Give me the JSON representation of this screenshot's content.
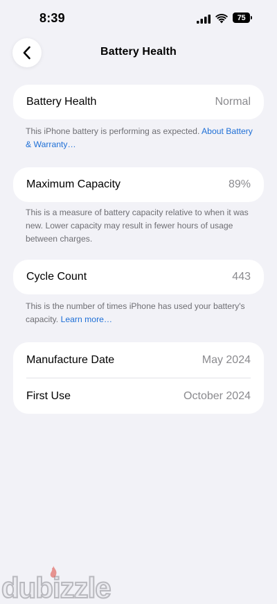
{
  "status_bar": {
    "time": "8:39",
    "battery_level": "75"
  },
  "nav": {
    "title": "Battery Health"
  },
  "health_card": {
    "label": "Battery Health",
    "value": "Normal"
  },
  "health_note": {
    "text": "This iPhone battery is performing as expected. ",
    "link": "About Battery & Warranty…"
  },
  "capacity_card": {
    "label": "Maximum Capacity",
    "value": "89%"
  },
  "capacity_note": {
    "text": "This is a measure of battery capacity relative to when it was new. Lower capacity may result in fewer hours of usage between charges."
  },
  "cycle_card": {
    "label": "Cycle Count",
    "value": "443"
  },
  "cycle_note": {
    "text": "This is the number of times iPhone has used your battery's capacity. ",
    "link": "Learn more…"
  },
  "dates_card": {
    "manufacture_label": "Manufacture Date",
    "manufacture_value": "May 2024",
    "first_use_label": "First Use",
    "first_use_value": "October 2024"
  },
  "watermark": {
    "text": "dubizzle"
  },
  "colors": {
    "background": "#f2f2f7",
    "card": "#ffffff",
    "link": "#1e6fd6",
    "secondary_text": "#8a8a8e"
  }
}
